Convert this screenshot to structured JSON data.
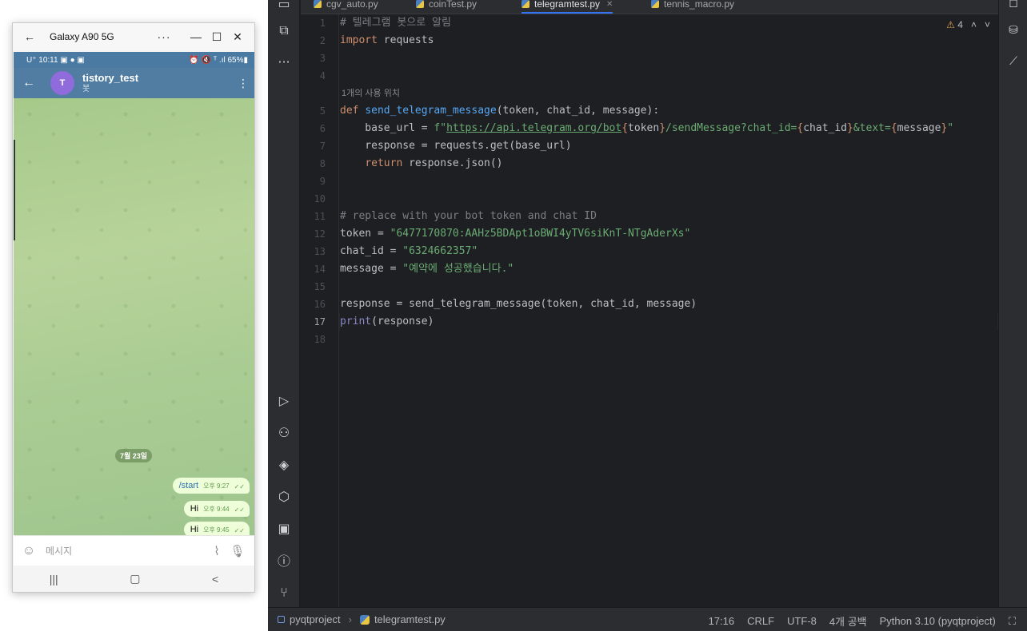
{
  "phone_window": {
    "title": "Galaxy A90 5G",
    "more": "···",
    "status": {
      "left": "U⁺ 10:11 ▣ ● ▣",
      "right": "⏰ 🔇 ᵀ .ıl 65%▮"
    },
    "chat": {
      "avatar_letter": "T",
      "name": "tistory_test",
      "subtitle": "봇",
      "date_chip": "7월 23일",
      "messages": [
        {
          "text": "/start",
          "time": "오후 9:27"
        },
        {
          "text": "Hi",
          "time": "오후 9:44"
        },
        {
          "text": "Hi",
          "time": "오후 9:45"
        }
      ],
      "input_placeholder": "메시지"
    },
    "nav": {
      "recents": "|||",
      "home": "▢",
      "back": "<"
    }
  },
  "ide": {
    "tabs": [
      {
        "label": "cgv_auto.py",
        "active": false
      },
      {
        "label": "coinTest.py",
        "active": false
      },
      {
        "label": "telegramtest.py",
        "active": true
      },
      {
        "label": "tennis_macro.py",
        "active": false
      }
    ],
    "inspection": {
      "warnings": "4"
    },
    "usage_hint": "1개의 사용 위치",
    "current_line": 17,
    "code": [
      {
        "n": "1",
        "html": "<span class='c-com'># 텔레그램 봇으로 알림</span>"
      },
      {
        "n": "2",
        "html": "<span class='c-kw'>import</span> requests"
      },
      {
        "n": "3",
        "html": ""
      },
      {
        "n": "4",
        "html": ""
      },
      {
        "n": "5",
        "html": "<span class='c-kw'>def</span> <span class='c-fn'>send_telegram_message</span>(token, chat_id, message):"
      },
      {
        "n": "6",
        "html": "    base_url = <span class='c-str'>f\"<span class='c-url'>https://api.telegram.org/bot</span></span><span class='c-brace'>{</span>token<span class='c-brace'>}</span><span class='c-str'>/sendMessage?chat_id=</span><span class='c-brace'>{</span>chat_id<span class='c-brace'>}</span><span class='c-str'>&amp;text=</span><span class='c-brace'>{</span>message<span class='c-brace'>}</span><span class='c-str'>\"</span>"
      },
      {
        "n": "7",
        "html": "    response = requests.get(base_url)"
      },
      {
        "n": "8",
        "html": "    <span class='c-kw'>return</span> response.json()"
      },
      {
        "n": "9",
        "html": ""
      },
      {
        "n": "10",
        "html": ""
      },
      {
        "n": "11",
        "html": "<span class='c-com'># replace with your bot token and chat ID</span>"
      },
      {
        "n": "12",
        "html": "token = <span class='c-str'>\"6477170870:AAHz5BDApt1oBWI4yTV6siKnT-NTgAderXs\"</span>"
      },
      {
        "n": "13",
        "html": "chat_id = <span class='c-str'>\"6324662357\"</span>"
      },
      {
        "n": "14",
        "html": "message = <span class='c-str'>\"예약에 성공했습니다.\"</span>"
      },
      {
        "n": "15",
        "html": ""
      },
      {
        "n": "16",
        "html": "response = send_telegram_message(token, chat_id, message)"
      },
      {
        "n": "17",
        "html": "<span class='c-bi'>print</span>(response)"
      },
      {
        "n": "18",
        "html": ""
      }
    ],
    "status": {
      "project": "pyqtproject",
      "file": "telegramtest.py",
      "position": "17:16",
      "line_sep": "CRLF",
      "encoding": "UTF-8",
      "indent": "4개 공백",
      "interpreter": "Python 3.10 (pyqtproject)"
    }
  }
}
